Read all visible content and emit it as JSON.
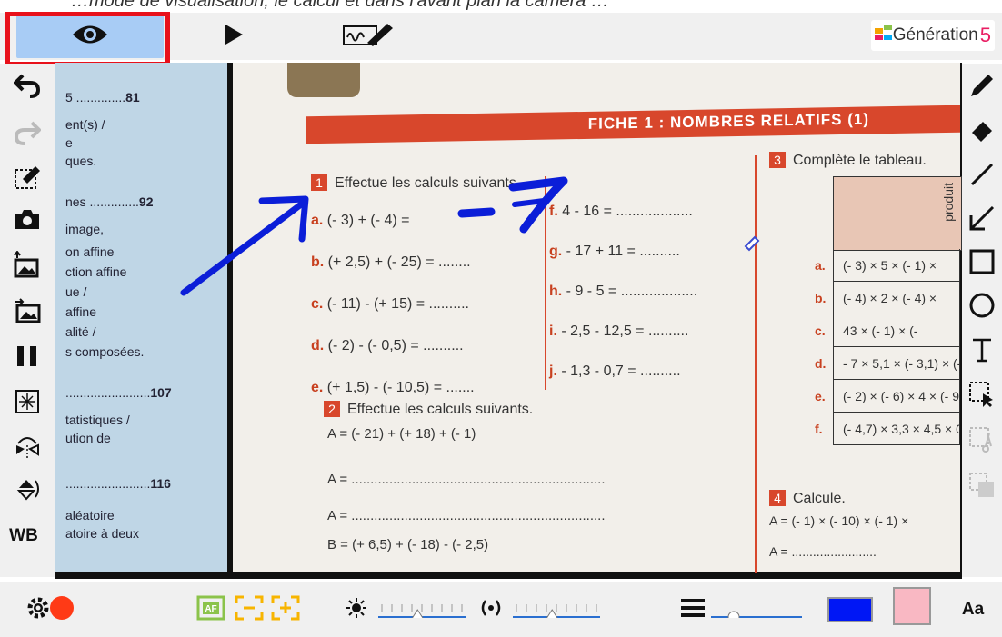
{
  "caption": "…mode de visualisation, le calcul et dans l'avant plan la camera …",
  "toolbar": {
    "view_mode_icon": "eye-icon",
    "play_icon": "play-icon",
    "annotate_icon": "signature-pen-icon",
    "logo_text": "Génération",
    "logo_num": "5"
  },
  "left_tools": [
    "undo-icon",
    "redo-icon",
    "clear-annotations-icon",
    "camera-icon",
    "import-image-icon",
    "export-image-icon",
    "pause-icon",
    "freeze-frame-icon",
    "flip-horizontal-icon",
    "flip-vertical-icon"
  ],
  "left_tools_wb": "WB",
  "right_tools": [
    "pencil-icon",
    "eraser-icon",
    "line-icon",
    "arrow-icon",
    "rectangle-icon",
    "circle-icon",
    "text-icon",
    "select-icon",
    "cut-icon",
    "copy-icon"
  ],
  "bottom": {
    "af_label": "AF",
    "text_size_label": "Aa",
    "brightness_level": 0.45,
    "contrast_level": 0.45,
    "line_width_level": 0.25,
    "colors": {
      "pen": "#0017f5",
      "highlight": "#f9b8c3",
      "record": "#ff3a16"
    }
  },
  "document": {
    "banner": "FICHE 1 : NOMBRES RELATIFS (1)",
    "left_index": [
      {
        "text": "5 ..............",
        "num": "81"
      },
      {
        "text": "ent(s) /",
        "num": ""
      },
      {
        "text": "e",
        "num": ""
      },
      {
        "text": "ques.",
        "num": ""
      },
      {
        "text": "nes ..............",
        "num": "92"
      },
      {
        "text": "image,",
        "num": ""
      },
      {
        "text": "on affine",
        "num": ""
      },
      {
        "text": "ction affine",
        "num": ""
      },
      {
        "text": "ue /",
        "num": ""
      },
      {
        "text": "affine",
        "num": ""
      },
      {
        "text": "alité /",
        "num": ""
      },
      {
        "text": "s composées.",
        "num": ""
      },
      {
        "text": "........................",
        "num": "107"
      },
      {
        "text": "tatistiques /",
        "num": ""
      },
      {
        "text": "ution de",
        "num": ""
      },
      {
        "text": "........................",
        "num": "116"
      },
      {
        "text": "aléatoire",
        "num": ""
      },
      {
        "text": "atoire à deux",
        "num": ""
      }
    ],
    "ex1_title": "Effectue les calculs suivants.",
    "ex1_left": [
      {
        "letter": "a.",
        "expr": "(- 3) + (- 4) ="
      },
      {
        "letter": "b.",
        "expr": "(+ 2,5) + (- 25) = ........"
      },
      {
        "letter": "c.",
        "expr": "(- 11) - (+ 15) = .........."
      },
      {
        "letter": "d.",
        "expr": "(- 2) - (- 0,5) = .........."
      },
      {
        "letter": "e.",
        "expr": "(+ 1,5) - (- 10,5) = ......."
      }
    ],
    "ex1_right": [
      {
        "letter": "f.",
        "expr": "4 - 16 = ..................."
      },
      {
        "letter": "g.",
        "expr": "- 17 + 11 = .........."
      },
      {
        "letter": "h.",
        "expr": "- 9 - 5 = ..................."
      },
      {
        "letter": "i.",
        "expr": "- 2,5 - 12,5 = .........."
      },
      {
        "letter": "j.",
        "expr": "- 1,3 - 0,7 = .........."
      }
    ],
    "ex2_title": "Effectue les calculs suivants.",
    "ex2_lines": [
      "A = (- 21) + (+ 18) + (- 1)",
      "A = ...................................................................",
      "A = ...................................................................",
      "B = (+ 6,5) + (- 18) - (- 2,5)"
    ],
    "ex3_title": "Complète le tableau.",
    "ex3_header": "produit",
    "ex3_rows": [
      {
        "letter": "a.",
        "expr": "(- 3) × 5 × (- 1) ×"
      },
      {
        "letter": "b.",
        "expr": "(- 4) × 2 × (- 4) ×"
      },
      {
        "letter": "c.",
        "expr": "43 × (- 1) × (-"
      },
      {
        "letter": "d.",
        "expr": "- 7 × 5,1 × (- 3,1) × (-"
      },
      {
        "letter": "e.",
        "expr": "(- 2) × (- 6) × 4 × (- 9,2"
      },
      {
        "letter": "f.",
        "expr": "(- 4,7) × 3,3 × 4,5 × 0"
      }
    ],
    "ex4_title": "Calcule.",
    "ex4_lines": [
      "A = (- 1) × (- 10) × (- 1) ×",
      "A = ........................"
    ],
    "handwriting": "-7"
  }
}
